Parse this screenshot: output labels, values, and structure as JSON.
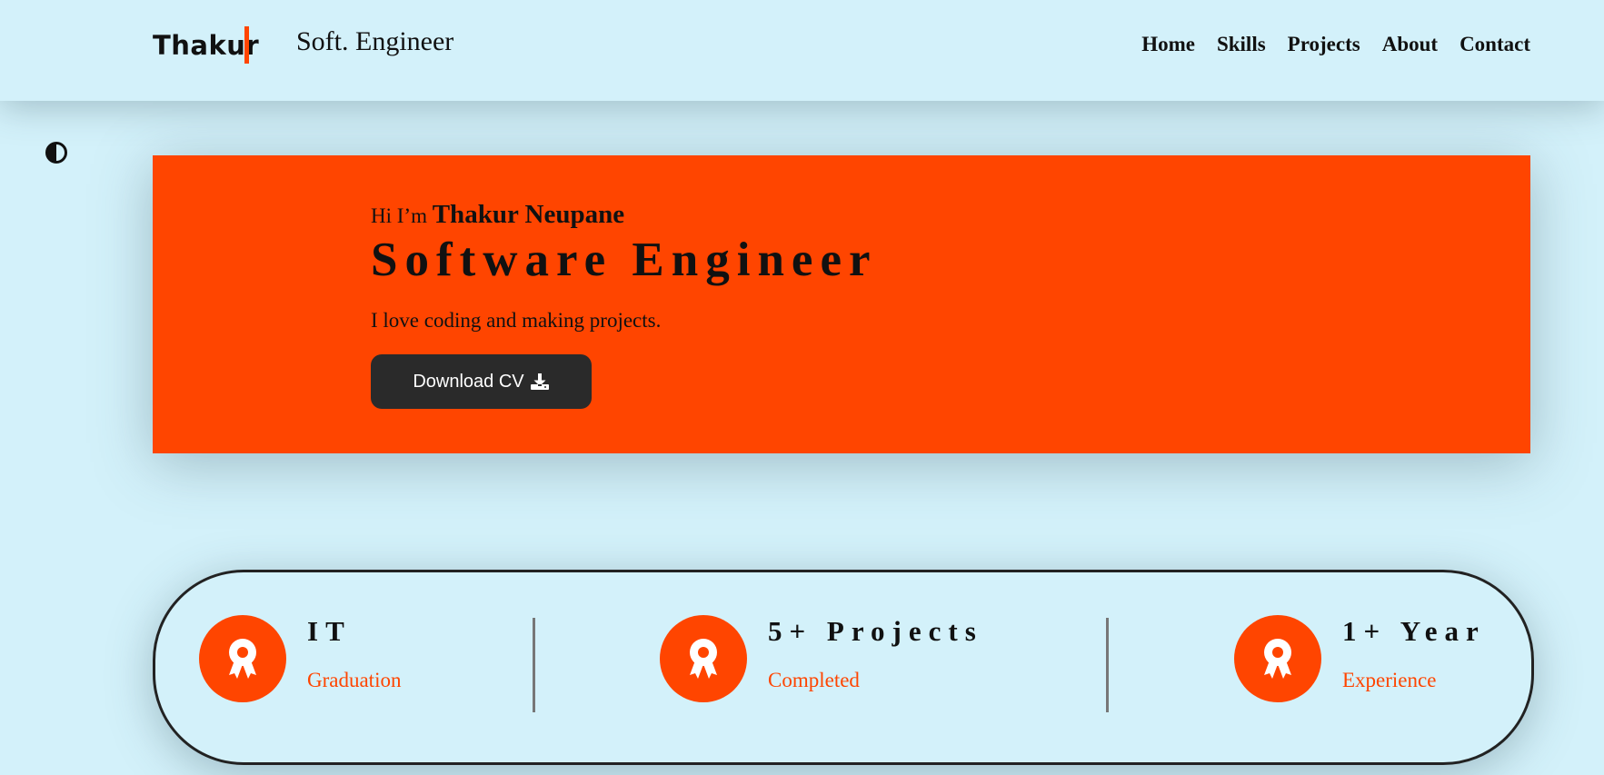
{
  "header": {
    "logo": "Thakur",
    "subtitle": "Soft. Engineer",
    "nav": [
      "Home",
      "Skills",
      "Projects",
      "About",
      "Contact"
    ]
  },
  "theme_toggle": {
    "icon": "contrast-icon"
  },
  "hero": {
    "greeting_prefix": "Hi I’m ",
    "name": "Thakur Neupane",
    "role": "Software Engineer",
    "tagline": "I love coding and making projects.",
    "button_label": "Download CV",
    "button_icon": "download-icon"
  },
  "stats": [
    {
      "title": "IT",
      "subtitle": "Graduation",
      "icon": "award-icon"
    },
    {
      "title": "5+ Projects",
      "subtitle": "Completed",
      "icon": "award-icon"
    },
    {
      "title": "1+ Year",
      "subtitle": "Experience",
      "icon": "award-icon"
    }
  ],
  "colors": {
    "accent": "#ff4500",
    "background": "#d3f1fa",
    "button_bg": "#2a2a2a",
    "text": "#111111"
  }
}
